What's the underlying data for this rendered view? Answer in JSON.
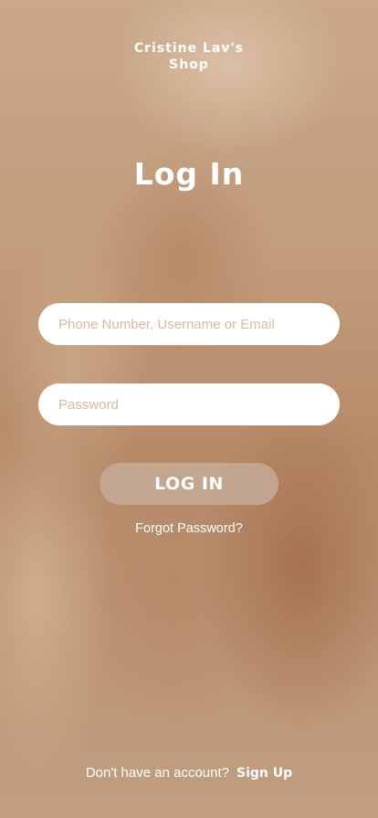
{
  "header": {
    "shop_name_line1": "Cristine Lav's",
    "shop_name_line2": "Shop",
    "title": "Log In"
  },
  "form": {
    "username_placeholder": "Phone Number, Username or Email",
    "username_value": "",
    "password_placeholder": "Password",
    "password_value": "",
    "login_label": "LOG IN",
    "forgot_label": "Forgot Password?"
  },
  "footer": {
    "prompt": "Don't have an account?",
    "signup_label": "Sign Up"
  },
  "colors": {
    "background": "#c29d7e",
    "text": "#ffffff",
    "placeholder": "#d9b7aa",
    "button": "#c4aa98"
  }
}
